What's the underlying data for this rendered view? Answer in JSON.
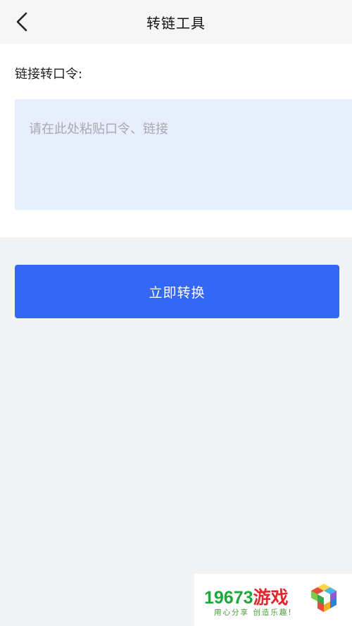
{
  "header": {
    "back_icon": "chevron-left-icon",
    "title": "转链工具"
  },
  "form": {
    "label": "链接转口令:",
    "input_value": "",
    "input_placeholder": "请在此处粘贴口令、链接"
  },
  "actions": {
    "convert_label": "立即转换"
  },
  "watermark": {
    "number": "19673",
    "name": "游戏",
    "slogan": "用心分享 创造乐趣!",
    "icon": "colorful-cube-icon"
  },
  "colors": {
    "primary": "#3468f4",
    "input_bg": "#e7eefc",
    "page_bg": "#f2f3f5",
    "watermark_green": "#1aa83a",
    "watermark_red": "#e2262c"
  }
}
